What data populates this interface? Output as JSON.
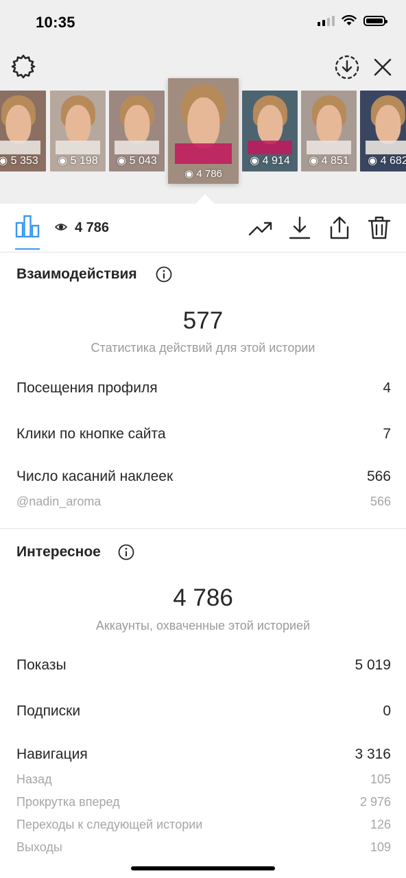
{
  "status_bar": {
    "time": "10:35"
  },
  "colors": {
    "accent": "#3897f0",
    "text": "#262626",
    "muted": "#9a9a9a",
    "caption_pink": "#c2185b"
  },
  "stories": [
    {
      "views": "5 353",
      "bg": "#8a6f62",
      "caption_style": "light"
    },
    {
      "views": "5 198",
      "bg": "#b7a89e",
      "caption_style": "light"
    },
    {
      "views": "5 043",
      "bg": "#9c8880",
      "caption_style": "light"
    },
    {
      "views": "4 786",
      "bg": "#a18d7f",
      "caption_style": "pink",
      "active": true
    },
    {
      "views": "4 914",
      "bg": "#4c6470",
      "caption_style": "pink"
    },
    {
      "views": "4 851",
      "bg": "#a89b94",
      "caption_style": "light"
    },
    {
      "views": "4 682",
      "bg": "#3a4660",
      "caption_style": "light"
    }
  ],
  "toolbar": {
    "views": "4 786",
    "icons": [
      "bar-chart-icon",
      "eye-icon",
      "trend-icon",
      "download-icon",
      "share-icon",
      "trash-icon"
    ]
  },
  "interactions": {
    "title": "Взаимодействия",
    "total": "577",
    "subtitle": "Статистика действий для этой истории",
    "rows": [
      {
        "label": "Посещения профиля",
        "value": "4"
      },
      {
        "label": "Клики по кнопке сайта",
        "value": "7"
      },
      {
        "label": "Число касаний наклеек",
        "value": "566"
      }
    ],
    "sticker": {
      "label": "@nadin_aroma",
      "value": "566"
    }
  },
  "discovery": {
    "title": "Интересное",
    "total": "4 786",
    "subtitle": "Аккаунты, охваченные этой историей",
    "rows": [
      {
        "label": "Показы",
        "value": "5 019"
      },
      {
        "label": "Подписки",
        "value": "0"
      },
      {
        "label": "Навигация",
        "value": "3 316"
      }
    ],
    "navigation_sub": [
      {
        "label": "Назад",
        "value": "105"
      },
      {
        "label": "Прокрутка вперед",
        "value": "2 976"
      },
      {
        "label": "Переходы к следующей истории",
        "value": "126"
      },
      {
        "label": "Выходы",
        "value": "109"
      }
    ]
  }
}
